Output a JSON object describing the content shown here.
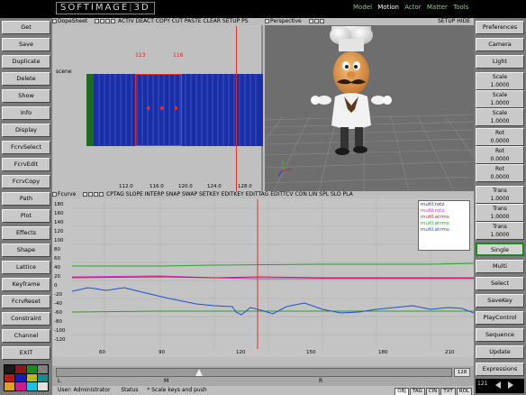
{
  "app": {
    "logo_left": "SOFTIMAGE",
    "logo_right": "3D"
  },
  "modes": [
    "Model",
    "Motion",
    "Actor",
    "Matter",
    "Tools"
  ],
  "active_mode": "Motion",
  "left_buttons": [
    "Get",
    "Save",
    "Duplicate",
    "Delete",
    "Show",
    "Info",
    "Display",
    "FcrvSelect",
    "FcrvEdit",
    "FcrvCopy",
    "Path",
    "Plot",
    "Effects",
    "Shape",
    "Lattice",
    "Keyframe",
    "FcrvReset",
    "Constraint",
    "Channel",
    "EXIT"
  ],
  "right_buttons_top": [
    "Preferences",
    "Camera",
    "Light"
  ],
  "right_value_boxes": [
    {
      "label": "Scale",
      "value": "1.0000"
    },
    {
      "label": "Scale",
      "value": "1.0000"
    },
    {
      "label": "Scale",
      "value": "1.0000"
    },
    {
      "label": "Rot",
      "value": "0.0000"
    },
    {
      "label": "Rot",
      "value": "0.0000"
    },
    {
      "label": "Rot",
      "value": "0.0000"
    },
    {
      "label": "Trans",
      "value": "1.0000"
    },
    {
      "label": "Trans",
      "value": "1.0000"
    },
    {
      "label": "Trans",
      "value": "1.0000"
    }
  ],
  "right_buttons_bottom": [
    "Single",
    "Multi",
    "Select",
    "SaveKey",
    "PlayControl",
    "Sequence",
    "Update",
    "Expressions"
  ],
  "dopesheet": {
    "title": "DopeSheet",
    "toolbar": "ACTIV  DEACT  COPY  CUT  PASTE  CLEAR  SETUP  PS",
    "track_label": "scene",
    "marker_a": "113",
    "marker_b": "116",
    "ticks": [
      "112.0",
      "116.0",
      "120.0",
      "124.0",
      "128.0"
    ]
  },
  "perspective": {
    "title": "Perspective",
    "toolbar": "SETUP  HIDE"
  },
  "fcurve": {
    "title": "Fcurve",
    "toolbar": "CPTAG  SLOPE  INTERP  SNAP  SWAP  SETKEY  EDITKEY  EDITTAG  EDITTCV  CON  LIN  SPL  SLO  PLA",
    "legend": [
      {
        "name": "mutll.rotz",
        "color": "#1a2fa5"
      },
      {
        "name": "mutll.rotz",
        "color": "#d030d0"
      },
      {
        "name": "mutll.atrms",
        "color": "#d02020"
      },
      {
        "name": "mutll.atrms",
        "color": "#2aa02a"
      },
      {
        "name": "mutll.atrms",
        "color": "#2050d0"
      }
    ],
    "y_ticks": [
      "180",
      "160",
      "140",
      "120",
      "100",
      "80",
      "60",
      "40",
      "20",
      "0",
      "-20",
      "-40",
      "-60",
      "-80",
      "-100",
      "-120"
    ],
    "x_ticks": [
      "60",
      "90",
      "120",
      "150",
      "180",
      "210"
    ]
  },
  "timeline": {
    "end_frame": "128",
    "marker_left": "L",
    "marker_mid": "M",
    "marker_right": "R"
  },
  "statusbar": {
    "user_label": "User",
    "user": "Administrator",
    "status_label": "Status",
    "status": "* Scale keys and push",
    "tabs": [
      "OBJ",
      "TAG",
      "CIN",
      "TXT",
      "ROL"
    ],
    "active_tab": "OBJ"
  },
  "frame_controls": {
    "frame_value": "121"
  },
  "colors": {
    "bg": "#000000",
    "panel": "#c9c9c9",
    "accent_green": "#8fd08f",
    "dope_blue": "#1a2fa5",
    "dope_green": "#1d6b1d",
    "red": "#e03030"
  },
  "palette_colors": [
    "#1a1a1a",
    "#8a1a1a",
    "#1a8a1a",
    "#808080",
    "#b81a1a",
    "#1a1ab8",
    "#b8b81a",
    "#1a8a8a",
    "#e0a020",
    "#d01a8a",
    "#20c0e0",
    "#e0e0e0"
  ]
}
